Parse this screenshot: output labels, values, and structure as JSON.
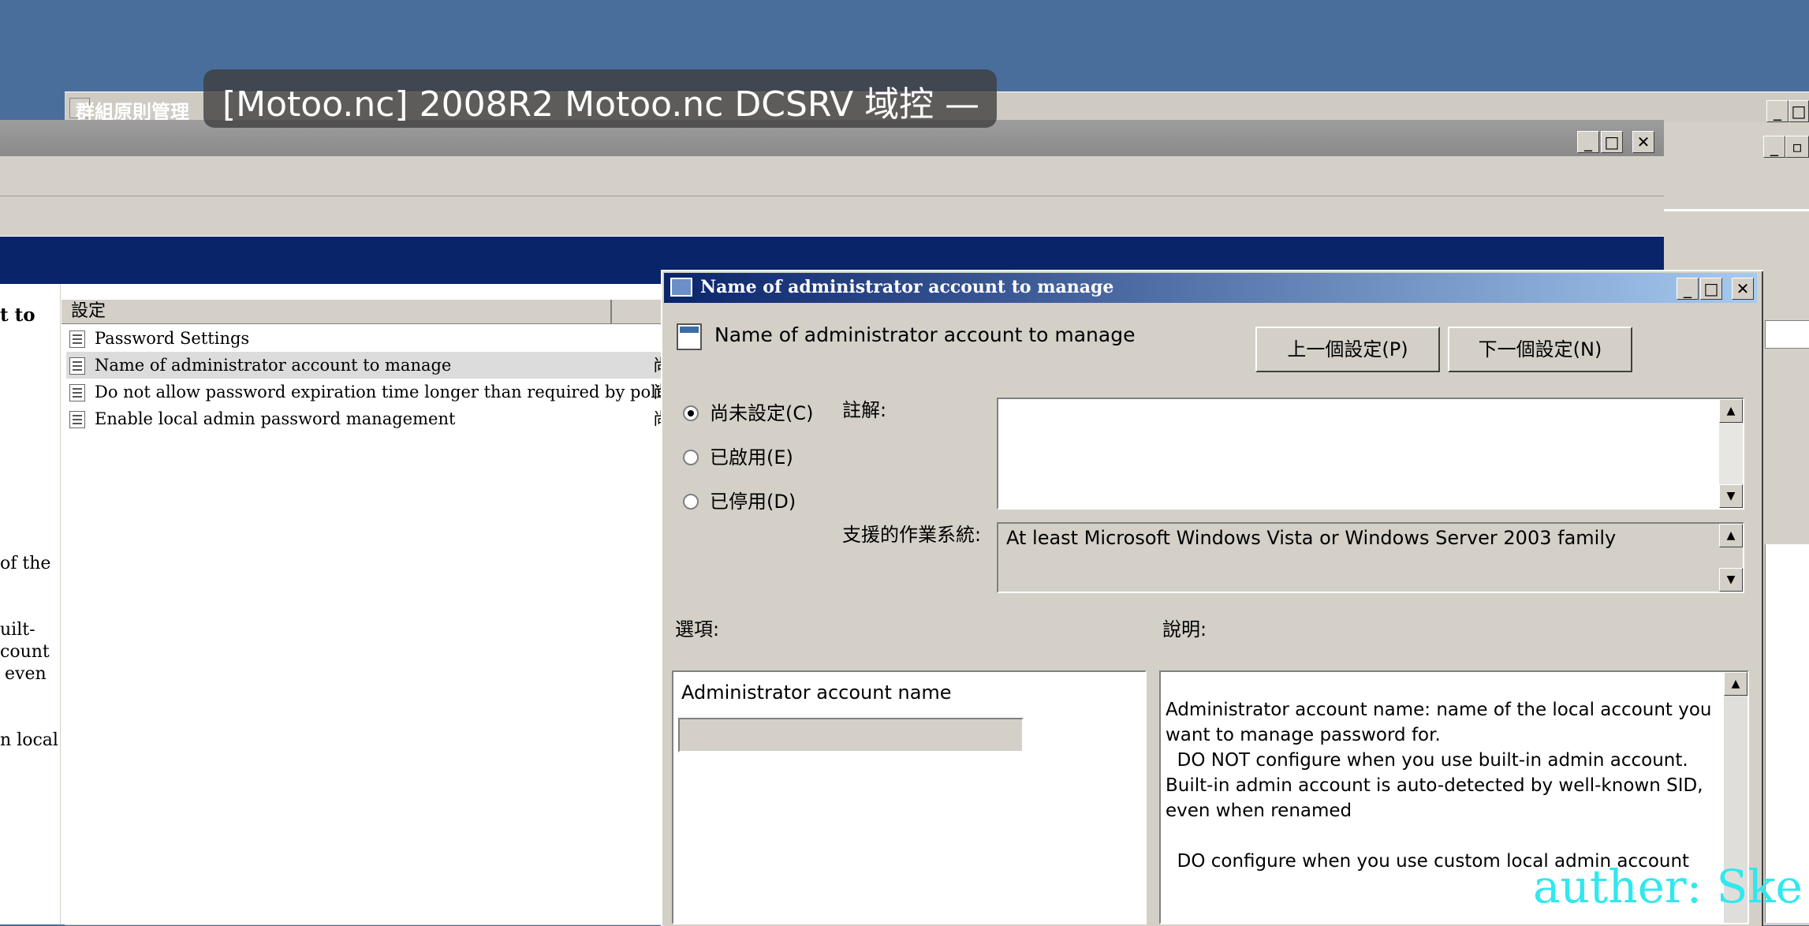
{
  "background_window": {
    "title": "群組原則管理"
  },
  "left_pane": {
    "fragments": [
      "t to",
      "of the",
      "uilt-",
      "count",
      "even",
      "n local"
    ]
  },
  "list": {
    "column_header": "設定",
    "rows": [
      {
        "label": "Password Settings",
        "state": ""
      },
      {
        "label": "Name of administrator account to manage",
        "state": "尚"
      },
      {
        "label": "Do not allow password expiration time longer than required by policy",
        "state": "尚"
      },
      {
        "label": "Enable local admin password management",
        "state": "尚"
      }
    ]
  },
  "dialog": {
    "title": "Name of administrator account to manage",
    "policy_name": "Name of administrator account to manage",
    "prev_button": "上一個設定(P)",
    "next_button": "下一個設定(N)",
    "radios": [
      {
        "label": "尚未設定(C)",
        "checked": true
      },
      {
        "label": "已啟用(E)",
        "checked": false
      },
      {
        "label": "已停用(D)",
        "checked": false
      }
    ],
    "comment_label": "註解:",
    "comment_value": "",
    "supported_label": "支援的作業系統:",
    "supported_value": "At least Microsoft Windows Vista or Windows Server 2003 family",
    "options_label": "選項:",
    "help_label": "說明:",
    "option_field_label": "Administrator account name",
    "option_field_value": "",
    "help_text": "Administrator account name: name of the local account you want to manage password for.\n  DO NOT configure when you use built-in admin account. Built-in admin account is auto-detected by well-known SID, even when renamed\n\n  DO configure when you use custom local admin account"
  },
  "overlay": {
    "caption": "[Motoo.nc] 2008R2 Motoo.nc DCSRV 域控 —",
    "watermark": "auther: Ske"
  },
  "colors": {
    "desktop": "#4a6e9c",
    "title_gradient_start": "#0a246a",
    "title_gradient_end": "#a6caf0",
    "face": "#d4d0c8",
    "watermark": "#30e8ee"
  },
  "icons": {
    "minimize": "minimize-icon",
    "maximize": "maximize-icon",
    "close": "close-icon",
    "policy": "policy-setting-icon"
  }
}
